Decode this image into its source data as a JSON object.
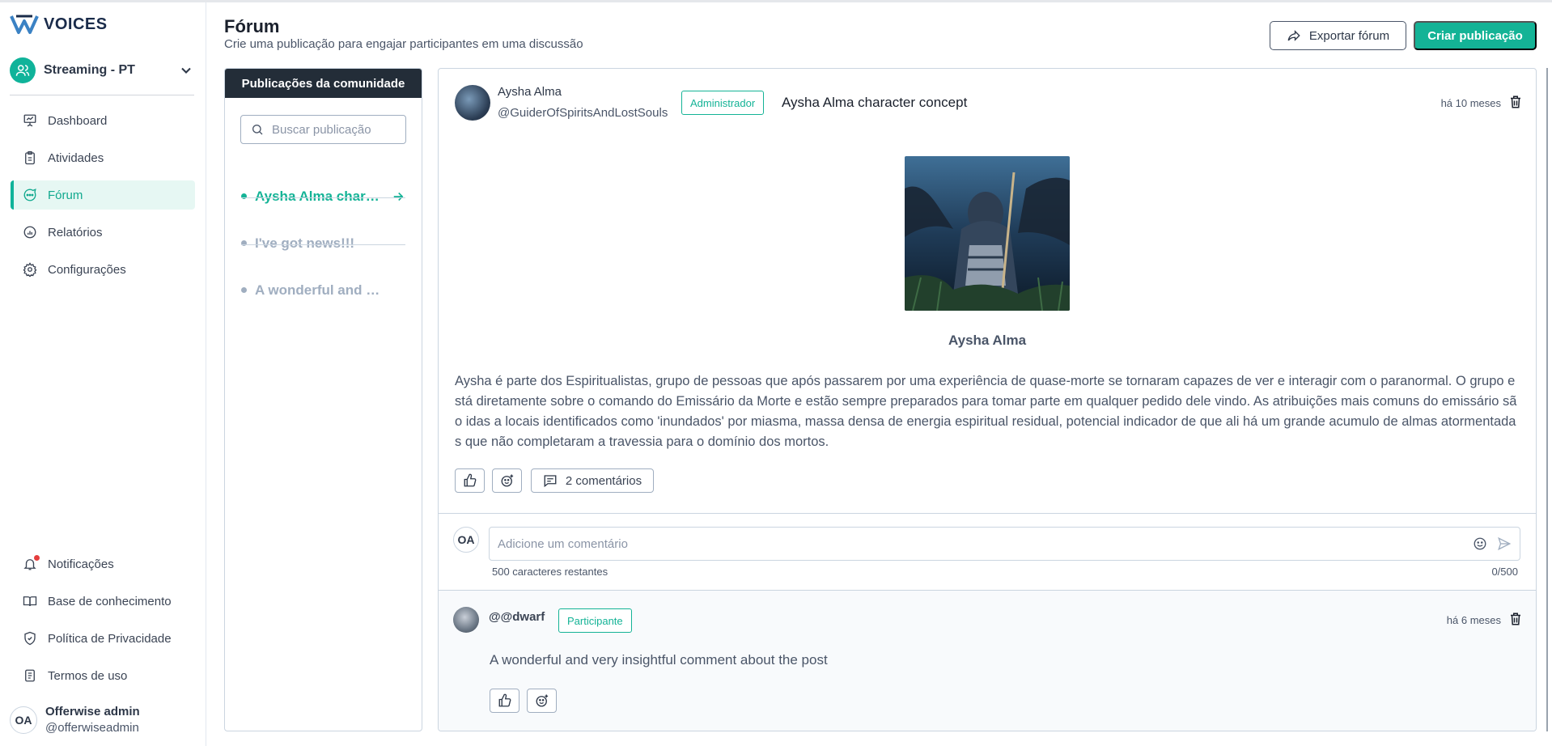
{
  "app": {
    "logo_text": "VOICES"
  },
  "workspace": {
    "name": "Streaming - PT"
  },
  "nav": {
    "items": [
      {
        "label": "Dashboard"
      },
      {
        "label": "Atividades"
      },
      {
        "label": "Fórum"
      },
      {
        "label": "Relatórios"
      },
      {
        "label": "Configurações"
      }
    ],
    "bottom": [
      {
        "label": "Notificações"
      },
      {
        "label": "Base de conhecimento"
      },
      {
        "label": "Política de Privacidade"
      },
      {
        "label": "Termos de uso"
      }
    ]
  },
  "user": {
    "initials": "OA",
    "name": "Offerwise admin",
    "handle": "@offerwiseadmin"
  },
  "header": {
    "title": "Fórum",
    "subtitle": "Crie uma publicação para engajar participantes em uma discussão",
    "export_label": "Exportar fórum",
    "create_label": "Criar publicação"
  },
  "list": {
    "heading": "Publicações da comunidade",
    "search_placeholder": "Buscar publicação",
    "posts": [
      {
        "title": "Aysha Alma character concept"
      },
      {
        "title": "I've got news!!!"
      },
      {
        "title": "A wonderful and very insightful post"
      }
    ]
  },
  "post": {
    "author_name": "Aysha Alma",
    "author_handle": "@GuiderOfSpiritsAndLostSouls",
    "role_badge": "Administrador",
    "title": "Aysha Alma character concept",
    "time": "há 10 meses",
    "image_caption": "Aysha Alma",
    "body": " Aysha é parte dos Espiritualistas, grupo de pessoas que após passarem por uma experiência de quase-morte se tornaram capazes de ver e interagir com o paranormal. O grupo está diretamente sobre o comando do Emissário da Morte e estão sempre preparados para tomar parte em qualquer pedido dele vindo. As atribuições mais comuns do emissário são idas a locais identificados como 'inundados' por miasma, massa densa de energia espiritual residual, potencial indicador de que ali há um grande acumulo de almas atormentadas que não completaram a travessia para o domínio dos mortos.",
    "comments_label": "2 comentários"
  },
  "comment_form": {
    "avatar_initials": "OA",
    "placeholder": "Adicione um comentário",
    "chars_left": "500 caracteres restantes",
    "count": "0/500"
  },
  "reply": {
    "user": "@@dwarf",
    "role_badge": "Participante",
    "time": "há 6 meses",
    "text": "A wonderful and very insightful comment about the post"
  },
  "colors": {
    "accent": "#14b396",
    "dark_header": "#232d38",
    "danger_dot": "#e53e3e"
  }
}
